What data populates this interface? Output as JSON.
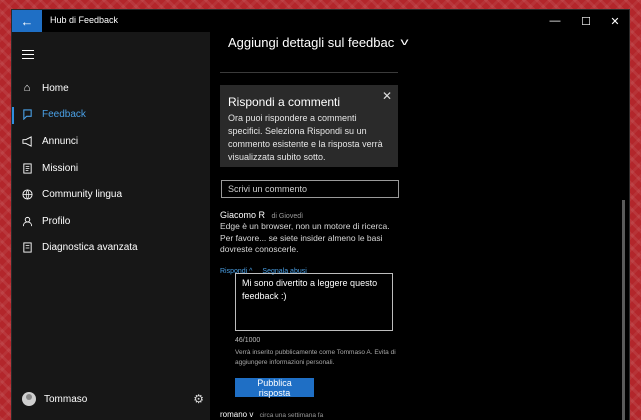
{
  "window": {
    "title": "Hub di Feedback",
    "back_icon": "back-arrow-icon",
    "minimize": "—",
    "maximize": "☐",
    "close": "✕"
  },
  "sidebar": {
    "items": [
      {
        "label": "Home",
        "icon": "home-icon"
      },
      {
        "label": "Feedback",
        "icon": "feedback-icon",
        "active": true
      },
      {
        "label": "Annunci",
        "icon": "megaphone-icon"
      },
      {
        "label": "Missioni",
        "icon": "quest-icon"
      },
      {
        "label": "Community lingua",
        "icon": "globe-icon"
      },
      {
        "label": "Profilo",
        "icon": "person-icon"
      },
      {
        "label": "Diagnostica avanzata",
        "icon": "diagnostics-icon"
      }
    ],
    "user": {
      "name": "Tommaso"
    }
  },
  "main": {
    "dropdown_label": "Aggiungi dettagli sul feedbac",
    "card": {
      "title": "Rispondi a commenti",
      "text": "Ora puoi rispondere a commenti specifici. Seleziona Rispondi su un commento esistente e la risposta verrà visualizzata subito sotto."
    },
    "comment_placeholder": "Scrivi un commento",
    "comment": {
      "author": "Giacomo R",
      "date": "di Giovedì",
      "text": "Edge è un browser, non un motore di ricerca. Per favore... se siete insider almeno le basi dovreste conoscerle.",
      "reply_label": "Rispondi ^",
      "report_label": "Segnala abusi"
    },
    "reply": {
      "text": "Mi sono divertito a leggere questo feedback :)",
      "counter": "46/1000",
      "notice": "Verrà inserito pubblicamente come Tommaso A. Evita di aggiungere informazioni personali.",
      "publish_label": "Pubblica risposta"
    },
    "next_comment": {
      "author": "romano v",
      "date": "circa una settimana fa"
    }
  },
  "colors": {
    "accent": "#1f6fc5",
    "link": "#4aa0e6",
    "background": "#000000",
    "sidebar": "#171717"
  }
}
